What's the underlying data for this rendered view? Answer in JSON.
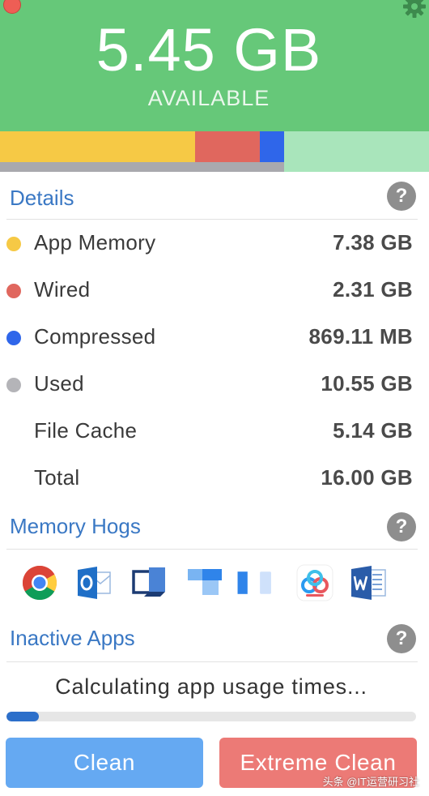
{
  "header": {
    "available_value": "5.45 GB",
    "available_label": "AVAILABLE",
    "background_color": "#66c879"
  },
  "memory_bar": {
    "segments": [
      {
        "name": "App Memory",
        "color": "#f6c945",
        "fraction": 0.455
      },
      {
        "name": "Wired",
        "color": "#e0675e",
        "fraction": 0.151
      },
      {
        "name": "Compressed",
        "color": "#2f66ea",
        "fraction": 0.057
      }
    ],
    "available_color": "#a9e5bb",
    "used_color": "#a9a9ae"
  },
  "details": {
    "title": "Details",
    "help": "?",
    "rows": [
      {
        "label": "App Memory",
        "value": "7.38 GB",
        "dot_color": "#f6c945"
      },
      {
        "label": "Wired",
        "value": "2.31 GB",
        "dot_color": "#e0675e"
      },
      {
        "label": "Compressed",
        "value": "869.11 MB",
        "dot_color": "#2f66ea"
      },
      {
        "label": "Used",
        "value": "10.55 GB",
        "dot_color": "#b4b4b8"
      },
      {
        "label": "File Cache",
        "value": "5.14 GB",
        "dot_color": ""
      },
      {
        "label": "Total",
        "value": "16.00 GB",
        "dot_color": ""
      }
    ]
  },
  "memory_hogs": {
    "title": "Memory Hogs",
    "help": "?",
    "apps": [
      {
        "icon": "chrome-icon"
      },
      {
        "icon": "outlook-icon"
      },
      {
        "icon": "remote-desktop-icon"
      },
      {
        "icon": "app-tiles-icon"
      },
      {
        "icon": "app-split-icon"
      },
      {
        "icon": "baidu-cloud-icon"
      },
      {
        "icon": "word-icon"
      }
    ]
  },
  "inactive_apps": {
    "title": "Inactive Apps",
    "help": "?",
    "status": "Calculating app usage times...",
    "progress": 0.08
  },
  "buttons": {
    "clean": "Clean",
    "extreme_clean": "Extreme Clean"
  },
  "watermark": "头条 @IT运营研习社"
}
